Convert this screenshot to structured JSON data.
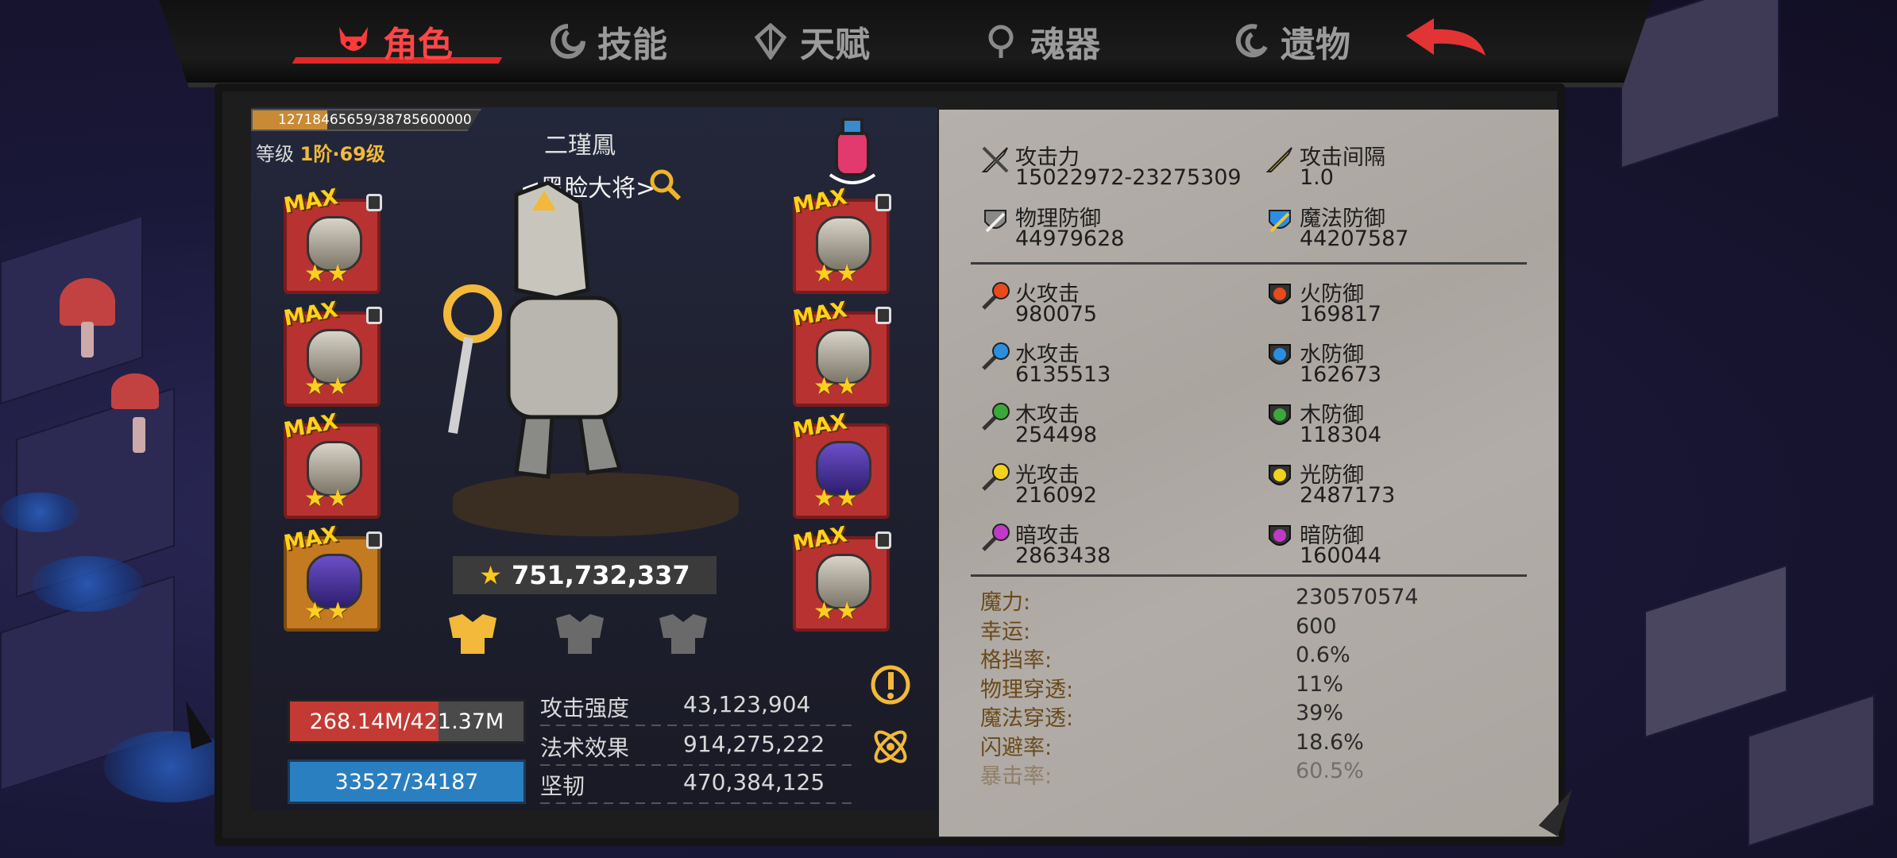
{
  "tabs": [
    {
      "label": "角色",
      "active": true,
      "icon": "devil-icon"
    },
    {
      "label": "技能",
      "active": false,
      "icon": "swirl-icon"
    },
    {
      "label": "天赋",
      "active": false,
      "icon": "gem-icon"
    },
    {
      "label": "魂器",
      "active": false,
      "icon": "soul-icon"
    },
    {
      "label": "遗物",
      "active": false,
      "icon": "relic-icon"
    }
  ],
  "character": {
    "xp_text": "12718465659/38785600000",
    "xp_progress": 0.328,
    "level_prefix": "等级",
    "level_value": "1阶·69级",
    "name": "二瑾鳳",
    "title": "<黑脸大将>",
    "power": "751,732,337",
    "hp_text": "268.14M/421.37M",
    "hp_progress": 0.636,
    "mp_text": "33527/34187",
    "attrs": [
      {
        "label": "攻击强度",
        "value": "43,123,904"
      },
      {
        "label": "法术效果",
        "value": "914,275,222"
      },
      {
        "label": "坚韧",
        "value": "470,384,125"
      }
    ],
    "equip_badge": "MAX",
    "equip_stars": "★★"
  },
  "stats": {
    "basic": [
      {
        "label": "攻击力",
        "value": "15022972-23275309",
        "icon": "sword-icon"
      },
      {
        "label": "攻击间隔",
        "value": "1.0",
        "icon": "gold-sword-icon"
      },
      {
        "label": "物理防御",
        "value": "44979628",
        "icon": "shield-sword-icon"
      },
      {
        "label": "魔法防御",
        "value": "44207587",
        "icon": "magic-defense-icon"
      }
    ],
    "elements": [
      {
        "atk_label": "火攻击",
        "atk_value": "980075",
        "def_label": "火防御",
        "def_value": "169817",
        "color": "#e84a1c"
      },
      {
        "atk_label": "水攻击",
        "atk_value": "6135513",
        "def_label": "水防御",
        "def_value": "162673",
        "color": "#2a8fe0"
      },
      {
        "atk_label": "木攻击",
        "atk_value": "254498",
        "def_label": "木防御",
        "def_value": "118304",
        "color": "#3aa83a"
      },
      {
        "atk_label": "光攻击",
        "atk_value": "216092",
        "def_label": "光防御",
        "def_value": "2487173",
        "color": "#f2d21a"
      },
      {
        "atk_label": "暗攻击",
        "atk_value": "2863438",
        "def_label": "暗防御",
        "def_value": "160044",
        "color": "#c03ac8"
      }
    ],
    "misc": [
      {
        "label": "魔力:",
        "value": "230570574"
      },
      {
        "label": "幸运:",
        "value": "600"
      },
      {
        "label": "格挡率:",
        "value": "0.6%"
      },
      {
        "label": "物理穿透:",
        "value": "11%"
      },
      {
        "label": "魔法穿透:",
        "value": "39%"
      },
      {
        "label": "闪避率:",
        "value": "18.6%"
      },
      {
        "label": "暴击率:",
        "value": "60.5%"
      }
    ]
  }
}
